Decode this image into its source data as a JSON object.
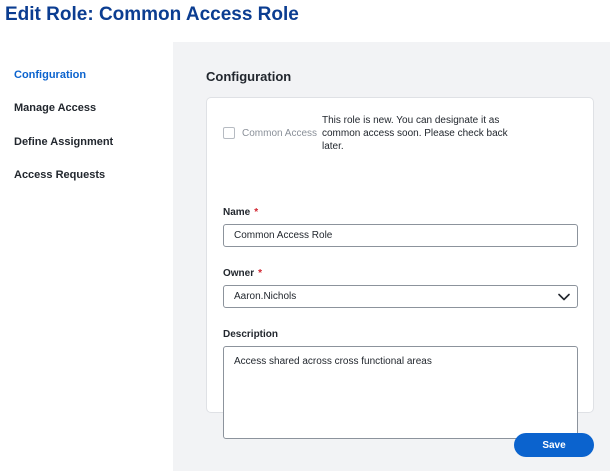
{
  "page": {
    "title": "Edit Role: Common Access Role"
  },
  "sidebar": {
    "items": [
      {
        "label": "Configuration",
        "active": true
      },
      {
        "label": "Manage Access",
        "active": false
      },
      {
        "label": "Define Assignment",
        "active": false
      },
      {
        "label": "Access Requests",
        "active": false
      }
    ]
  },
  "main": {
    "section_title": "Configuration",
    "common_access": {
      "label": "Common Access",
      "checked": false,
      "notice": "This role is new. You can designate it as common access soon. Please check back later."
    },
    "name": {
      "label": "Name",
      "required_mark": "*",
      "value": "Common Access Role"
    },
    "owner": {
      "label": "Owner",
      "required_mark": "*",
      "value": "Aaron.Nichols",
      "icon": "chevron-down-icon"
    },
    "description": {
      "label": "Description",
      "value": "Access shared across cross functional areas"
    },
    "save_label": "Save"
  },
  "colors": {
    "title": "#0b3d91",
    "accent": "#0b63ce",
    "required": "#d1242f",
    "main_background": "#f2f3f5"
  }
}
